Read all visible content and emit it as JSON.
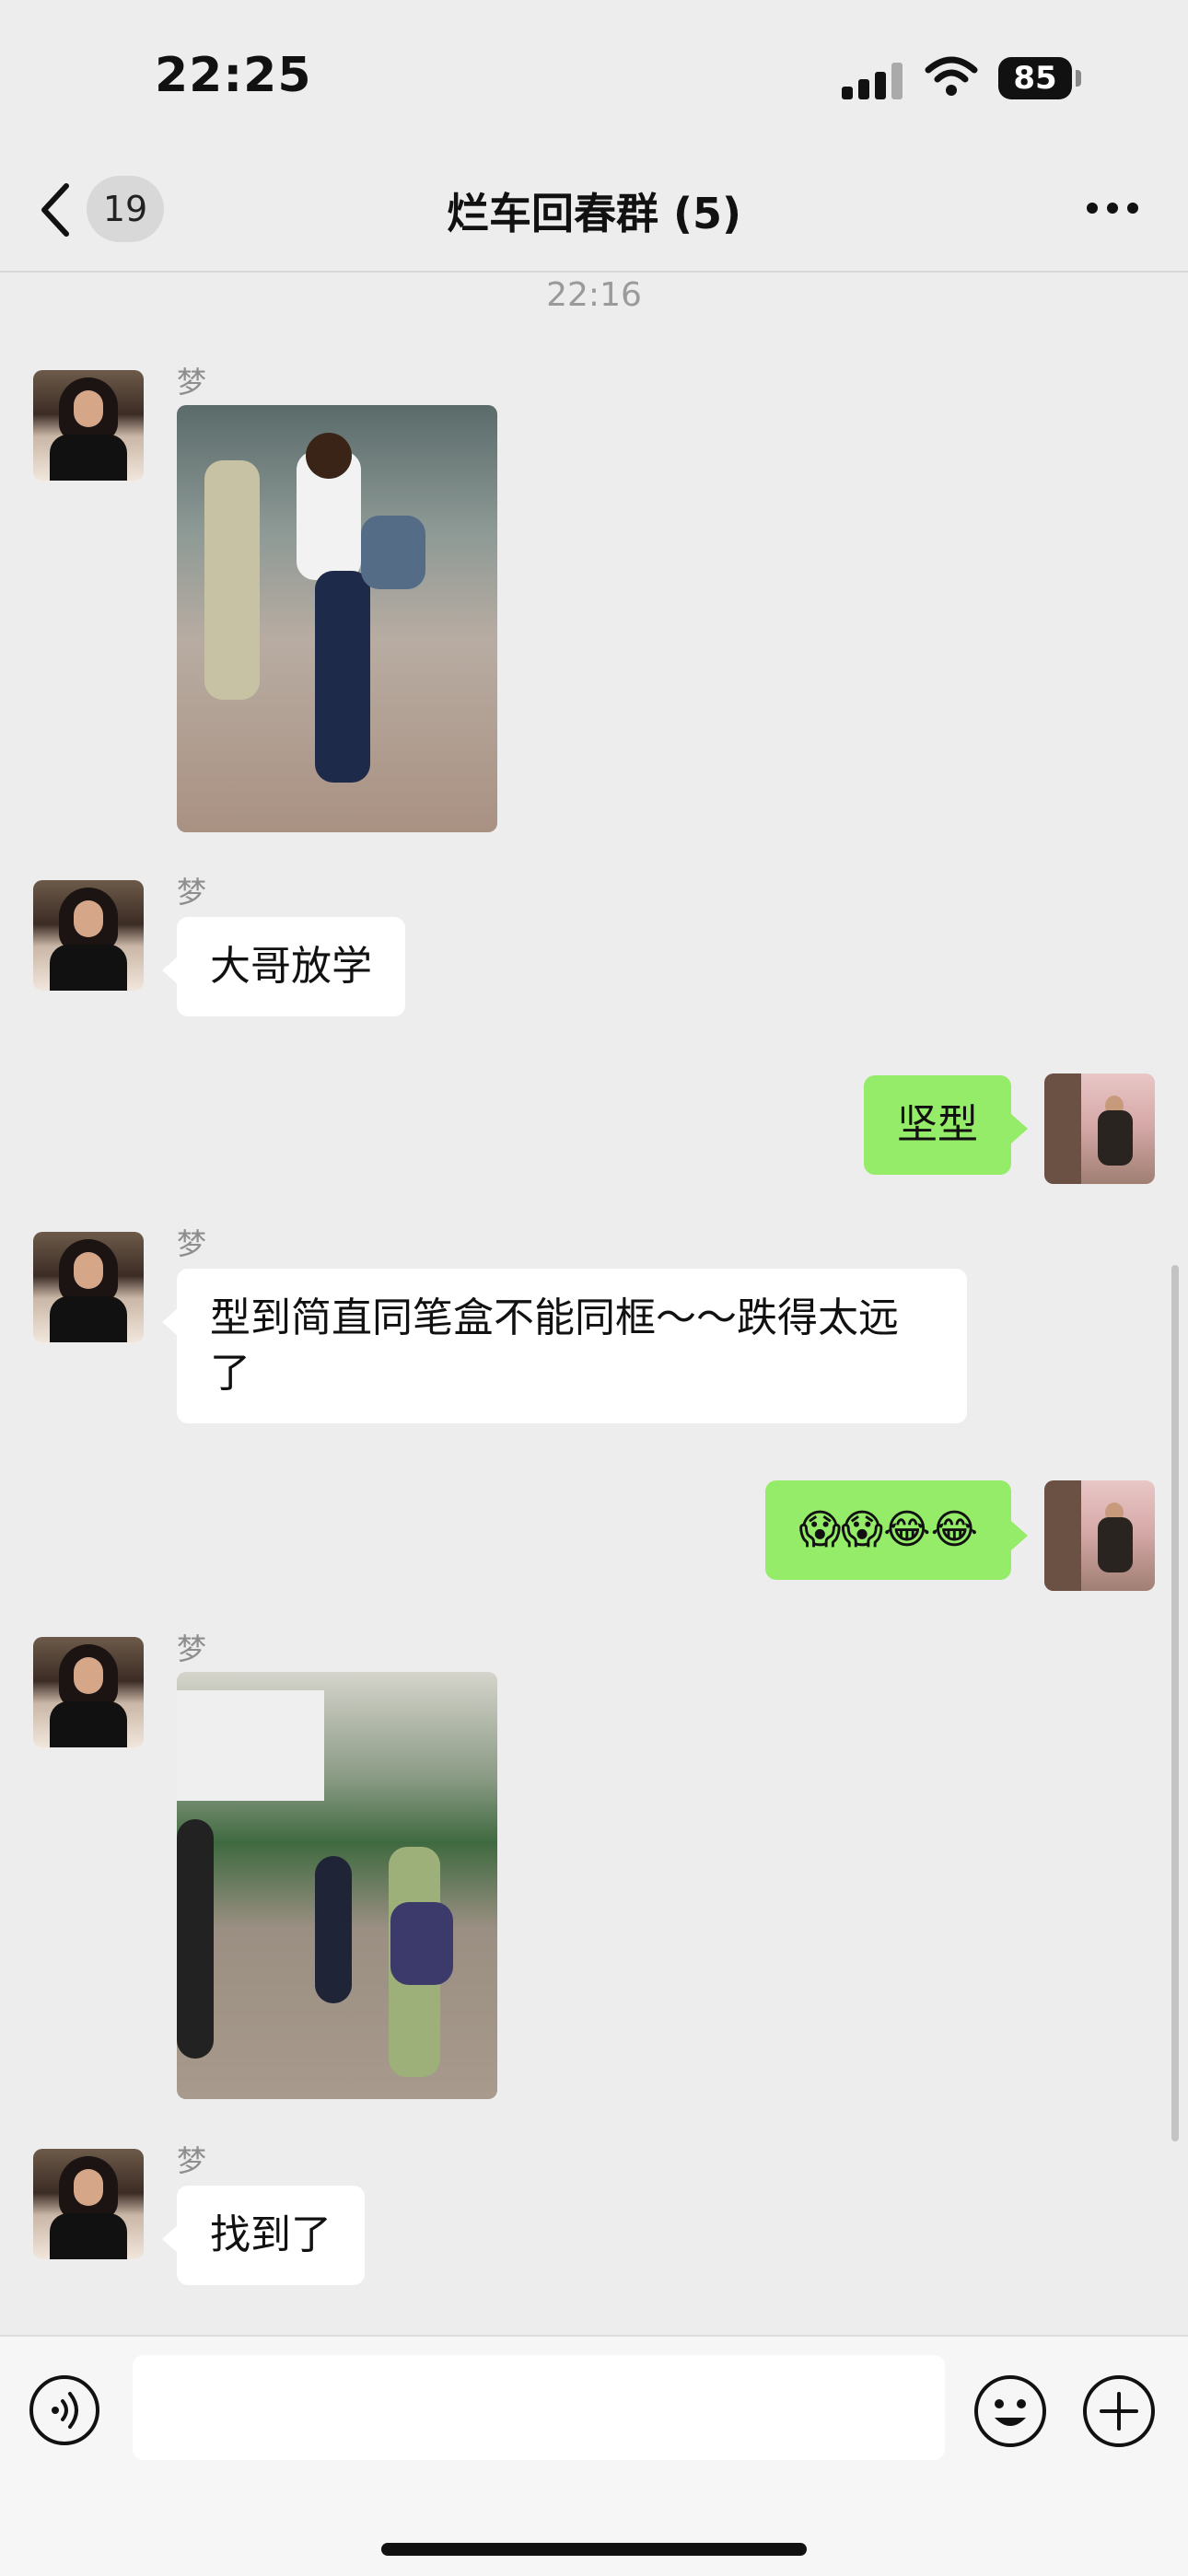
{
  "status_bar": {
    "time": "22:25",
    "battery": "85"
  },
  "nav": {
    "unread_count": "19",
    "title": "烂车回春群 (5)"
  },
  "chat": {
    "timestamp": "22:16",
    "messages": [
      {
        "sender": "梦",
        "type": "image"
      },
      {
        "sender": "梦",
        "type": "text",
        "text": "大哥放学"
      },
      {
        "sender": "me",
        "type": "text",
        "text": "坚型"
      },
      {
        "sender": "梦",
        "type": "text",
        "text": "型到简直同笔盒不能同框～～跌得太远了"
      },
      {
        "sender": "me",
        "type": "text",
        "text": "😱😱😂😂"
      },
      {
        "sender": "梦",
        "type": "image"
      },
      {
        "sender": "梦",
        "type": "text",
        "text": "找到了"
      }
    ]
  },
  "input": {
    "value": "",
    "placeholder": ""
  },
  "colors": {
    "outgoing_bubble": "#95ec69",
    "incoming_bubble": "#ffffff",
    "background": "#ededed"
  },
  "icons": [
    "back-icon",
    "more-icon",
    "voice-icon",
    "emoji-icon",
    "plus-icon"
  ]
}
